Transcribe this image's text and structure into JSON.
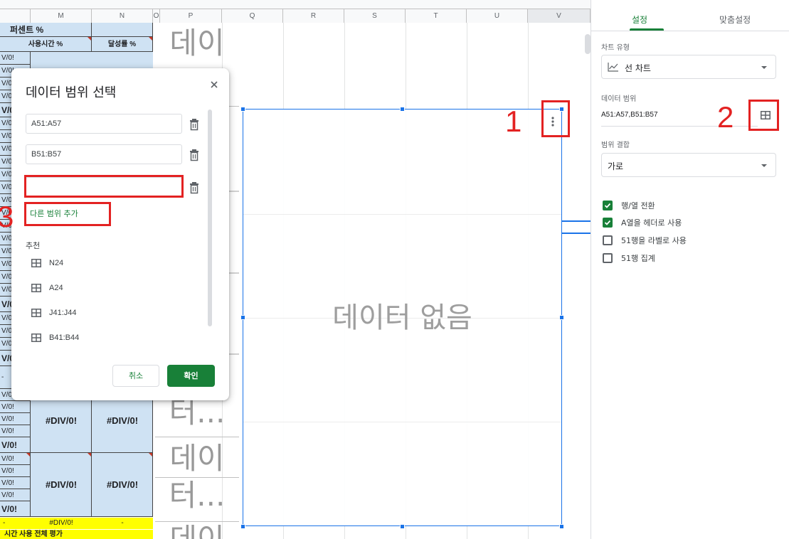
{
  "sheet": {
    "columns": [
      {
        "key": "L",
        "label": ""
      },
      {
        "key": "M",
        "label": "M"
      },
      {
        "key": "N",
        "label": "N"
      },
      {
        "key": "O",
        "label": "O"
      },
      {
        "key": "P",
        "label": "P"
      },
      {
        "key": "Q",
        "label": "Q"
      },
      {
        "key": "R",
        "label": "R"
      },
      {
        "key": "S",
        "label": "S"
      },
      {
        "key": "T",
        "label": "T"
      },
      {
        "key": "U",
        "label": "U"
      },
      {
        "key": "V",
        "label": "V"
      }
    ],
    "header_percent": "퍼센트 %",
    "header_usage_time": "사용시간 %",
    "header_achievement": "달성률 %",
    "row_values": [
      "V/0!",
      "V/0!",
      "V/0!",
      "V/0!",
      "V/0!",
      "V/0!",
      "V/0!",
      "V/0!",
      "V/0!",
      "V/0!",
      "V/0!",
      "V/0!",
      "V/0!",
      "V/0!",
      "V/0!",
      "V/0!",
      "V/0!",
      "V/0!",
      "V/0!"
    ],
    "div_error": "#DIV/0!",
    "dash": "-",
    "yellow_value": "#DIV/0!",
    "bottom_label": "시간 사용 전체 평가",
    "chart_placeholder_big": "데이",
    "chart_placeholder_big2": "터...",
    "chart_placeholder_first": "데이"
  },
  "chart": {
    "no_data": "데이터 없음",
    "menu_icon": "vertical-dots-icon"
  },
  "dialog": {
    "title": "데이터 범위 선택",
    "ranges": [
      "A51:A57",
      "B51:B57",
      ""
    ],
    "add_range": "다른 범위 추가",
    "suggestions_label": "추천",
    "suggestions": [
      "N24",
      "A24",
      "J41:J44",
      "B41:B44"
    ],
    "cancel": "취소",
    "ok": "확인"
  },
  "panel": {
    "tab_setup": "설정",
    "tab_customize": "맞춤설정",
    "chart_type_label": "차트 유형",
    "chart_type_value": "선 차트",
    "data_range_label": "데이터 범위",
    "data_range_value": "A51:A57,B51:B57",
    "combine_label": "범위 결합",
    "combine_value": "가로",
    "checkboxes": [
      {
        "label": "행/열 전환",
        "checked": true
      },
      {
        "label": "A열을 헤더로 사용",
        "checked": true
      },
      {
        "label": "51행을 라벨로 사용",
        "checked": false
      },
      {
        "label": "51행 집계",
        "checked": false
      }
    ]
  },
  "annotations": {
    "one": "1",
    "two": "2",
    "three": "3",
    "color": "#e32222"
  },
  "colors": {
    "accent_green": "#188038",
    "selection_blue": "#1a73e8",
    "cell_blue": "#cfe2f3",
    "highlight_yellow": "#ffff00"
  }
}
